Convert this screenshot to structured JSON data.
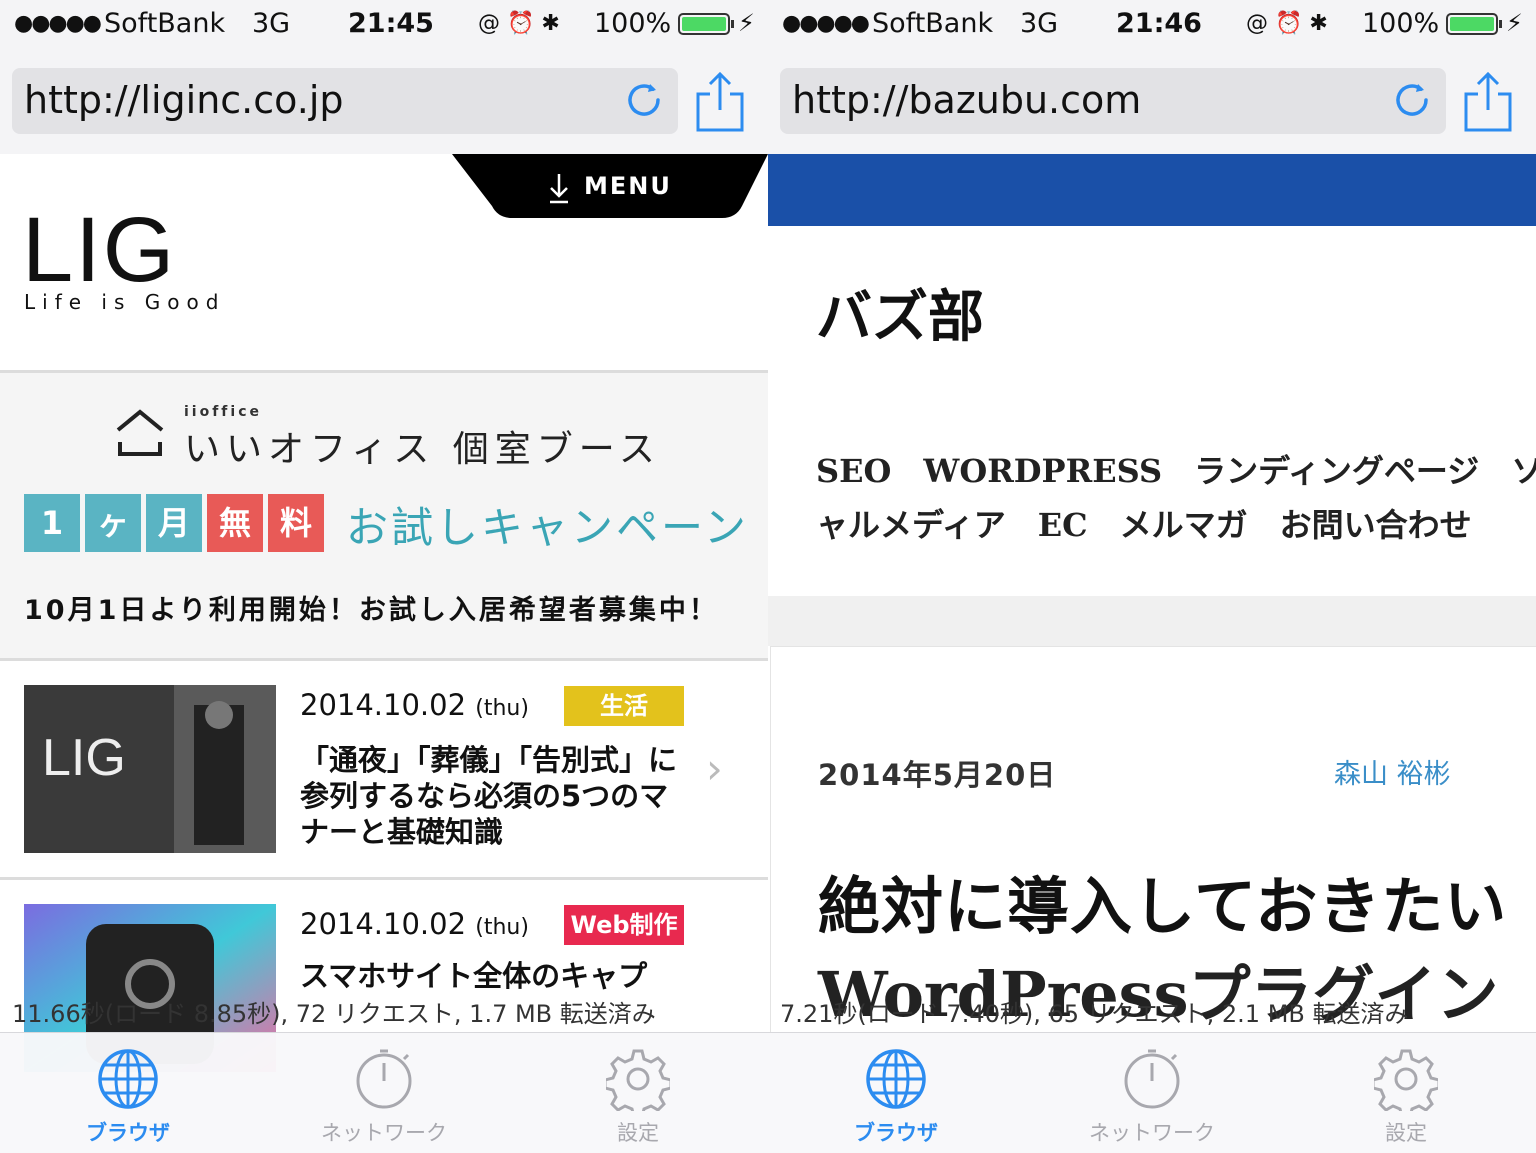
{
  "left": {
    "status": {
      "signal": "●●●●●",
      "carrier": "SoftBank",
      "network": "3G",
      "time": "21:45",
      "icons": "@ ⏰ ✱",
      "battery": "100%"
    },
    "url": "http://liginc.co.jp",
    "page": {
      "menu_label": "MENU",
      "logo": "LIG",
      "logo_sub": "Life is Good",
      "promo_small": "iioffice",
      "promo_title": "いいオフィス 個室ブース",
      "campaign_chips": [
        "1",
        "ヶ",
        "月",
        "無",
        "料"
      ],
      "campaign_text": "お試しキャンペーン",
      "promo_note": "10月1日より利用開始！お試し入居希望者募集中！",
      "articles": [
        {
          "date": "2014.10.02",
          "day": "(thu)",
          "badge": "生活",
          "title": "「通夜」「葬儀」「告別式」に参列するなら必須の5つのマナーと基礎知識",
          "thumb_text": "LIG"
        },
        {
          "date": "2014.10.02",
          "day": "(thu)",
          "badge": "Web制作",
          "title": "スマホサイト全体のキャプ"
        }
      ]
    },
    "stats": "11.66秒(ロード 8.85秒), 72 リクエスト, 1.7 MB 転送済み"
  },
  "right": {
    "status": {
      "signal": "●●●●●",
      "carrier": "SoftBank",
      "network": "3G",
      "time": "21:46",
      "icons": "@ ⏰ ✱",
      "battery": "100%"
    },
    "url": "http://bazubu.com",
    "page": {
      "title": "バズ部",
      "nav_line1": "SEO　WORDPRESS　ランディングページ　ソー",
      "nav_line2": "ャルメディア　EC　メルマガ　お問い合わせ",
      "post_date": "2014年5月20日",
      "author": "森山 裕彬",
      "post_title_1": "絶対に導入しておきたい",
      "post_title_2": "WordPressプラグイン"
    },
    "stats": "7.21秒(ロード 7.40秒), 65 リクエスト, 2.1 MB 転送済み"
  },
  "tabs": [
    {
      "label": "ブラウザ",
      "icon": "globe-icon",
      "active": true
    },
    {
      "label": "ネットワーク",
      "icon": "stopwatch-icon",
      "active": false
    },
    {
      "label": "設定",
      "icon": "gear-icon",
      "active": false
    }
  ],
  "colors": {
    "accent": "#2c8cf0",
    "lig_teal": "#5ab4c3",
    "lig_red": "#e85a57",
    "badge_yellow": "#e3c21c",
    "badge_red": "#e8294f",
    "bazubu_blue": "#1a50a8"
  }
}
